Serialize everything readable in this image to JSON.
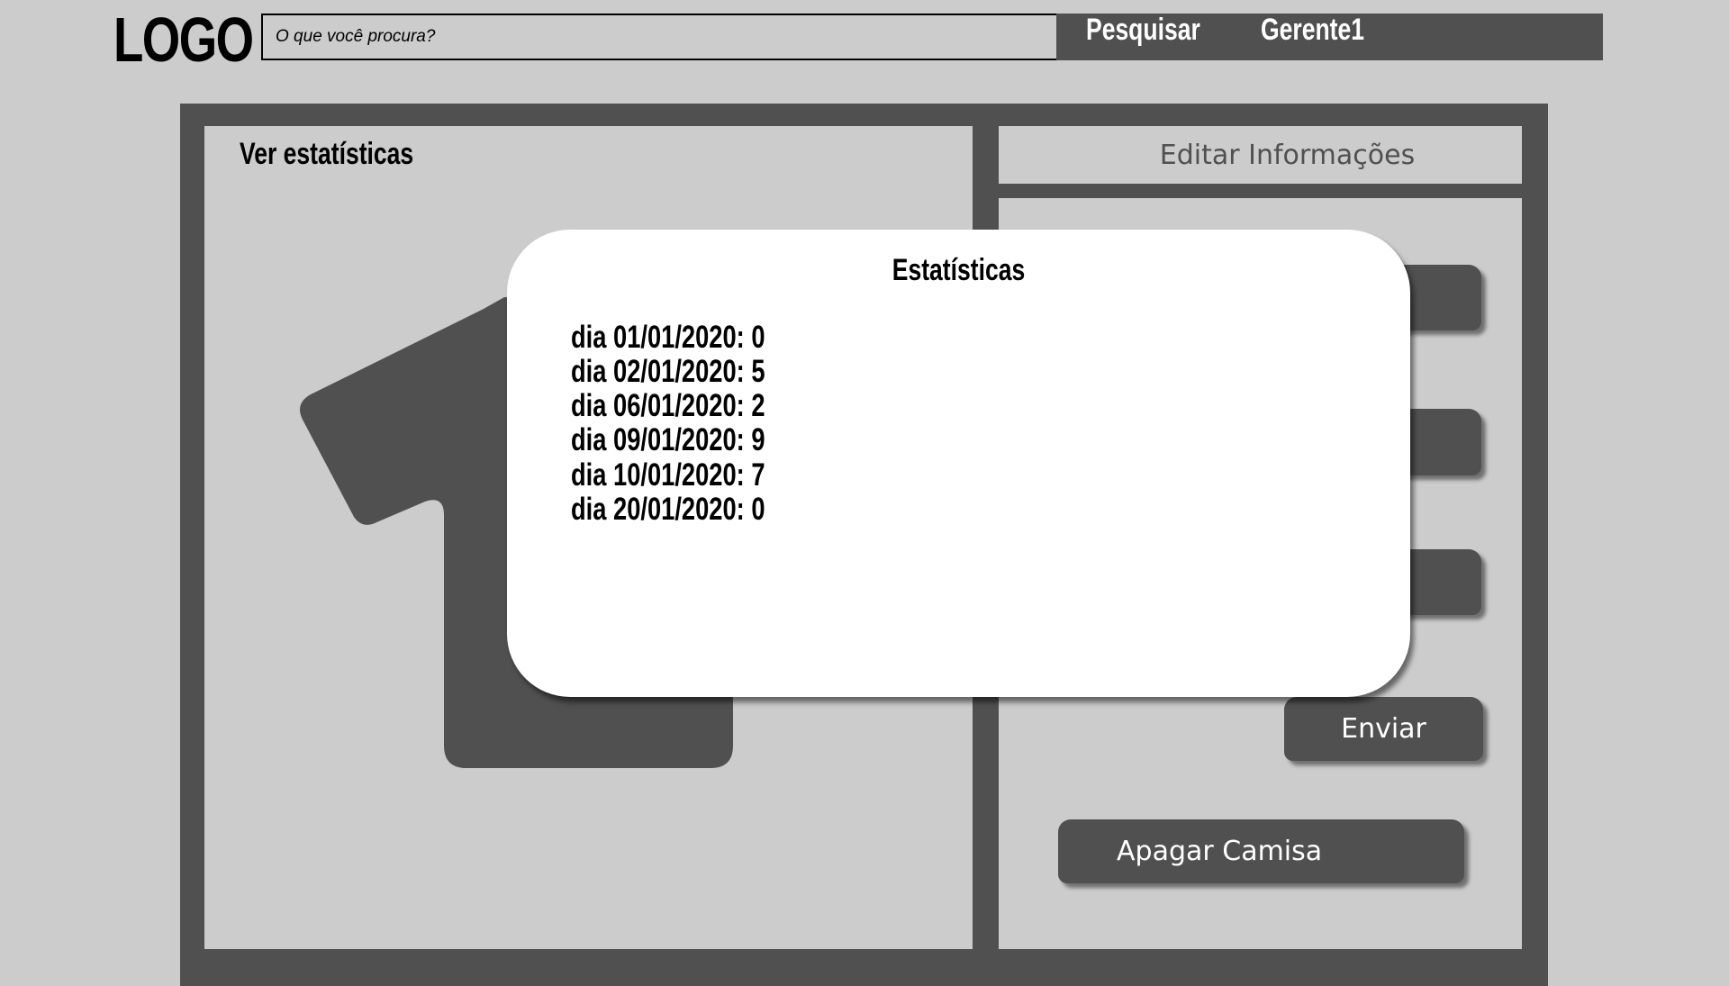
{
  "header": {
    "logo": "LOGO",
    "search_placeholder": "O que você procura?",
    "search_button": "Pesquisar",
    "user": "Gerente1"
  },
  "left_panel": {
    "title": "Ver estatísticas",
    "image_icon": "tshirt-icon"
  },
  "right_panel": {
    "header": "Editar Informações",
    "send_button": "Enviar",
    "delete_button": "Apagar Camisa"
  },
  "modal": {
    "title": "Estatísticas",
    "lines": [
      "dia 01/01/2020: 0",
      "dia 02/01/2020: 5",
      "dia 06/01/2020: 2",
      "dia 09/01/2020: 9",
      "dia 10/01/2020: 7",
      "dia 20/01/2020: 0"
    ]
  },
  "colors": {
    "background": "#cccccc",
    "dark": "#505050",
    "modal": "#ffffff"
  }
}
